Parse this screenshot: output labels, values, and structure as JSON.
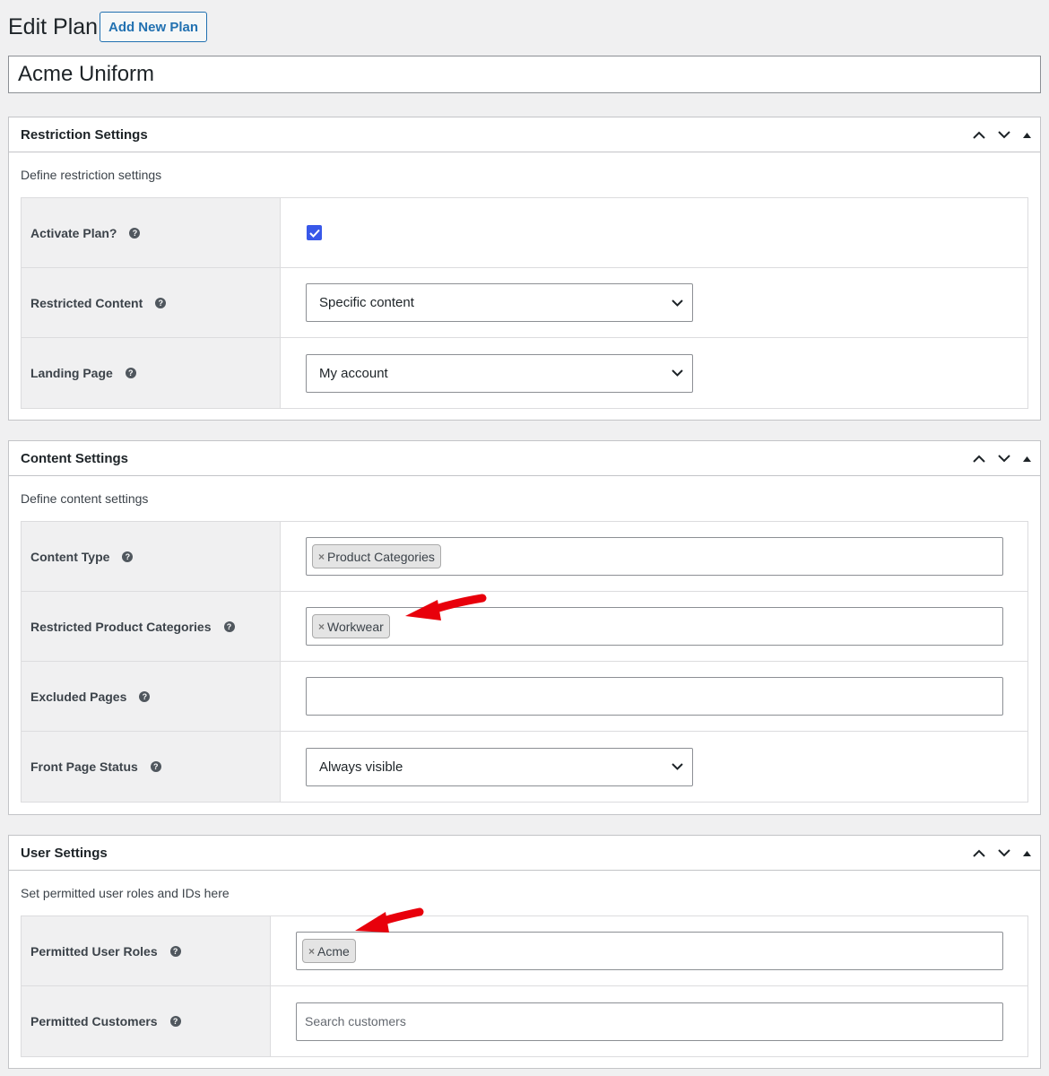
{
  "header": {
    "page_title": "Edit Plan",
    "add_new_label": "Add New Plan",
    "plan_title_value": "Acme Uniform"
  },
  "restriction": {
    "title": "Restriction Settings",
    "description": "Define restriction settings",
    "rows": [
      {
        "label": "Activate Plan?",
        "type": "checkbox",
        "checked": true
      },
      {
        "label": "Restricted Content",
        "type": "select",
        "value": "Specific content"
      },
      {
        "label": "Landing Page",
        "type": "select",
        "value": "My account"
      }
    ]
  },
  "content": {
    "title": "Content Settings",
    "description": "Define content settings",
    "rows": [
      {
        "label": "Content Type",
        "type": "tags",
        "tags": [
          "Product Categories"
        ]
      },
      {
        "label": "Restricted Product Categories",
        "type": "tags",
        "tags": [
          "Workwear"
        ]
      },
      {
        "label": "Excluded Pages",
        "type": "tags",
        "tags": []
      },
      {
        "label": "Front Page Status",
        "type": "select",
        "value": "Always visible"
      }
    ]
  },
  "user": {
    "title": "User Settings",
    "description": "Set permitted user roles and IDs here",
    "rows": [
      {
        "label": "Permitted User Roles",
        "type": "tags",
        "tags": [
          "Acme"
        ]
      },
      {
        "label": "Permitted Customers",
        "type": "search",
        "placeholder": "Search customers"
      }
    ]
  },
  "common": {
    "help_glyph": "?",
    "tag_remove_glyph": "×"
  },
  "colors": {
    "accent": "#2271b1",
    "checkbox": "#3858e9",
    "annotation_arrow": "#e8000b"
  }
}
